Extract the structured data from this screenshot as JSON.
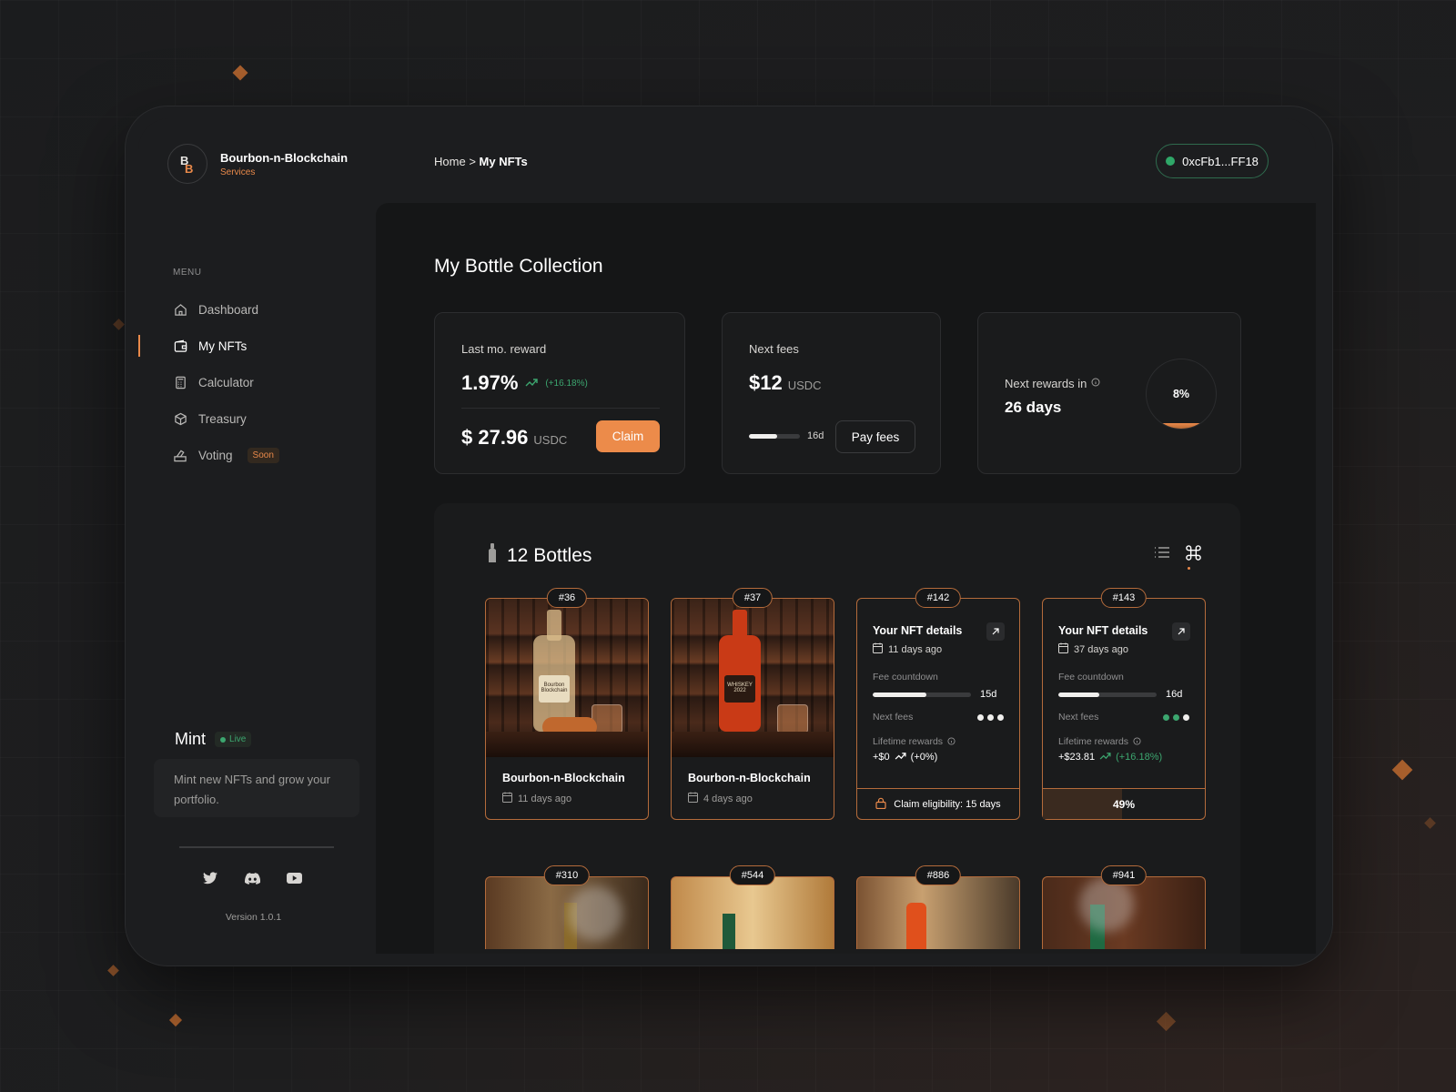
{
  "brand": {
    "name": "Bourbon-n-Blockchain",
    "sub": "Services"
  },
  "breadcrumb": {
    "home": "Home",
    "separator": ">",
    "current": "My NFTs"
  },
  "wallet": {
    "address": "0xcFb1...FF18"
  },
  "sidebar": {
    "menu_label": "MENU",
    "items": [
      {
        "label": "Dashboard",
        "icon": "home-icon"
      },
      {
        "label": "My NFTs",
        "icon": "wallet-icon",
        "active": true
      },
      {
        "label": "Calculator",
        "icon": "calculator-icon"
      },
      {
        "label": "Treasury",
        "icon": "cube-icon"
      },
      {
        "label": "Voting",
        "icon": "vote-icon",
        "badge": "Soon"
      }
    ],
    "mint": {
      "title": "Mint",
      "status": "Live",
      "text": "Mint new NFTs and grow your portfolio."
    },
    "version": "Version 1.0.1"
  },
  "page": {
    "title": "My Bottle Collection"
  },
  "stats": {
    "reward": {
      "label": "Last mo. reward",
      "percent": "1.97%",
      "change": "(+16.18%)",
      "amount": "$ 27.96",
      "unit": "USDC",
      "claim_label": "Claim"
    },
    "fees": {
      "label": "Next fees",
      "amount": "$12",
      "unit": "USDC",
      "countdown": "16d",
      "progress": 0.55,
      "pay_label": "Pay fees"
    },
    "next_rewards": {
      "label": "Next rewards in",
      "days": "26 days",
      "percent": "8%",
      "progress": 0.08
    }
  },
  "bottles": {
    "title": "12 Bottles",
    "cards": [
      {
        "id": "#36",
        "name": "Bourbon-n-Blockchain",
        "date": "11 days ago",
        "bottle_color": "#d9c9a8",
        "label": "Bourbon Blockchain"
      },
      {
        "id": "#37",
        "name": "Bourbon-n-Blockchain",
        "date": "4 days ago",
        "bottle_color": "#d8431a",
        "label": "WHISKEY 2022"
      }
    ],
    "details": [
      {
        "id": "#142",
        "title": "Your NFT details",
        "date": "11 days ago",
        "fee_label": "Fee countdown",
        "countdown": "15d",
        "fee_progress": 0.55,
        "next_fees_label": "Next fees",
        "dots": [
          "#f0efed",
          "#f0efed",
          "#f0efed"
        ],
        "lifetime_label": "Lifetime rewards",
        "lifetime_value": "+$0",
        "lifetime_change": "(+0%)",
        "footer": "Claim eligibility: 15 days"
      },
      {
        "id": "#143",
        "title": "Your NFT details",
        "date": "37 days ago",
        "fee_label": "Fee countdown",
        "countdown": "16d",
        "fee_progress": 0.42,
        "next_fees_label": "Next fees",
        "dots": [
          "#3ca66f",
          "#3ca66f",
          "#f0efed"
        ],
        "lifetime_label": "Lifetime rewards",
        "lifetime_value": "+$23.81",
        "lifetime_change": "(+16.18%)",
        "progress_label": "49%",
        "progress": 0.49
      }
    ],
    "row2": [
      {
        "id": "#310"
      },
      {
        "id": "#544"
      },
      {
        "id": "#886"
      },
      {
        "id": "#941"
      }
    ]
  }
}
